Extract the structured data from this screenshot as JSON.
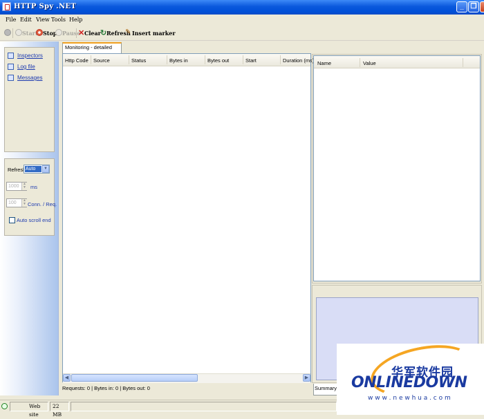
{
  "window": {
    "title": "HTTP Spy .NET",
    "buttons": {
      "minimize": "_",
      "maximize": "❐",
      "close": "✕"
    }
  },
  "menu": {
    "items": [
      "File",
      "Edit",
      "View",
      "Tools",
      "Help"
    ]
  },
  "toolbar": {
    "start": "Start",
    "stop": "Stop",
    "pause": "Pause",
    "clear": "Clear",
    "refresh": "Refresh",
    "insert_marker": "Insert marker"
  },
  "sidebar": {
    "links": [
      "Inspectors",
      "Log file",
      "Messages"
    ],
    "refresh_label": "Refresh",
    "refresh_value": "Auto",
    "interval_value": "1000",
    "interval_unit": "ms",
    "conn_value": "100",
    "conn_unit": "Conn. / Req.",
    "autoscroll_label": "Auto scroll end"
  },
  "main": {
    "tab": "Monitoring - detailed requests",
    "columns": [
      "Http Code",
      "Source",
      "Status",
      "Bytes in",
      "Bytes out",
      "Start",
      "Duration (ms)"
    ],
    "status": "Requests: 0 | Bytes in:  0 | Bytes out: 0"
  },
  "props": {
    "columns": [
      "Name",
      "Value"
    ],
    "tab": "Summary"
  },
  "statusbar": {
    "website": "Web site",
    "memory": "22 MB"
  },
  "watermark": {
    "cn": "华军软件园",
    "brand": "ONLINEDOWN",
    "url": "w w w . n e w h u a . c o m"
  },
  "colors": {
    "title_bar": "#0a58dc",
    "link": "#1c3ab0",
    "tab_accent": "#f0a020",
    "watermark_orange": "#f5a623",
    "watermark_blue": "#1a3aa0"
  }
}
